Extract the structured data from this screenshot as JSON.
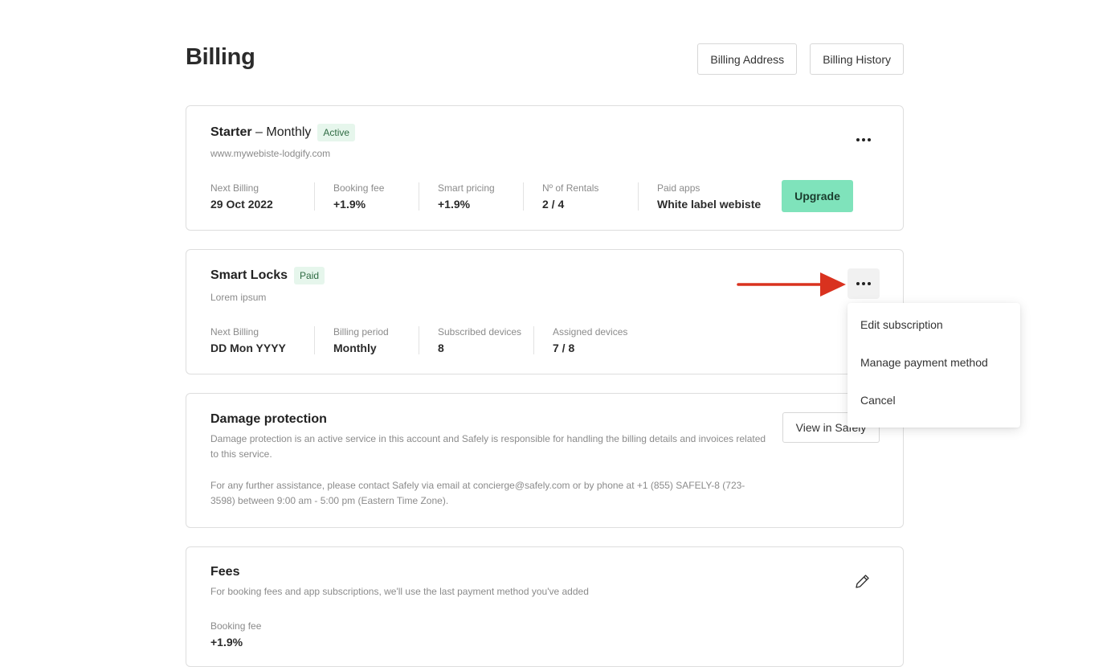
{
  "page": {
    "title": "Billing",
    "actions": {
      "billing_address": "Billing Address",
      "billing_history": "Billing History"
    }
  },
  "starter": {
    "plan_name": "Starter",
    "plan_period": "– Monthly",
    "badge": "Active",
    "website": "www.mywebiste-lodgify.com",
    "stats": [
      {
        "label": "Next Billing",
        "value": "29 Oct 2022"
      },
      {
        "label": "Booking fee",
        "value": "+1.9%"
      },
      {
        "label": "Smart pricing",
        "value": "+1.9%"
      },
      {
        "label": "Nº of Rentals",
        "value": "2 / 4"
      },
      {
        "label": "Paid apps",
        "value": "White label webiste"
      }
    ],
    "upgrade_label": "Upgrade",
    "more_icon": "more-horizontal-icon"
  },
  "smart_locks": {
    "name": "Smart Locks",
    "badge": "Paid",
    "description": "Lorem ipsum",
    "stats": [
      {
        "label": "Next Billing",
        "value": "DD Mon YYYY"
      },
      {
        "label": "Billing period",
        "value": "Monthly"
      },
      {
        "label": "Subscribed devices",
        "value": "8"
      },
      {
        "label": "Assigned devices",
        "value": "7 / 8"
      }
    ],
    "more_icon": "more-horizontal-icon",
    "menu": {
      "items": [
        "Edit subscription",
        "Manage payment method",
        "Cancel"
      ]
    }
  },
  "damage_protection": {
    "title": "Damage protection",
    "paragraph_1": "Damage protection is an active service in this account and Safely is responsible for handling the billing details and invoices related to this service.",
    "paragraph_2": "For any further assistance, please contact Safely via email at concierge@safely.com or by phone at +1 (855) SAFELY-8 (723-3598) between 9:00 am - 5:00 pm (Eastern Time Zone).",
    "button_label": "View in Safely"
  },
  "fees": {
    "title": "Fees",
    "description": "For booking fees and app subscriptions, we'll use the last payment method you've added",
    "booking_fee_label": "Booking fee",
    "booking_fee_value": "+1.9%",
    "edit_icon": "pencil-icon"
  },
  "colors": {
    "upgrade_bg": "#7fe3bb",
    "badge_bg": "#e6f6ec",
    "arrow": "#d9321f"
  }
}
